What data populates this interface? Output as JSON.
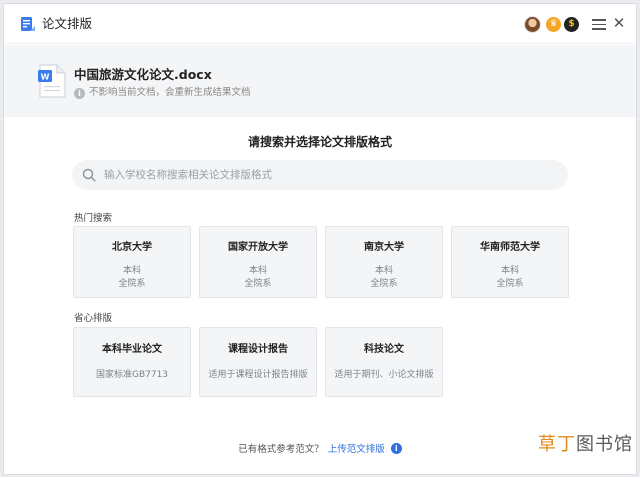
{
  "app": {
    "title": "论文排版"
  },
  "badges": {
    "vip": "♛",
    "coin": "$"
  },
  "file": {
    "name": "中国旅游文化论文.docx",
    "note": "不影响当前文档，会重新生成结果文档",
    "doc_letter": "W"
  },
  "main": {
    "heading": "请搜索并选择论文排版格式",
    "search_placeholder": "输入学校名称搜索相关论文排版格式"
  },
  "hot": {
    "label": "热门搜索",
    "cards": [
      {
        "title": "北京大学",
        "level": "本科",
        "scope": "全院系"
      },
      {
        "title": "国家开放大学",
        "level": "本科",
        "scope": "全院系"
      },
      {
        "title": "南京大学",
        "level": "本科",
        "scope": "全院系"
      },
      {
        "title": "华南师范大学",
        "level": "本科",
        "scope": "全院系"
      }
    ]
  },
  "easy": {
    "label": "省心排版",
    "cards": [
      {
        "title": "本科毕业论文",
        "desc": "国家标准GB7713"
      },
      {
        "title": "课程设计报告",
        "desc": "适用于课程设计报告排版"
      },
      {
        "title": "科技论文",
        "desc": "适用于期刊、小论文排版"
      }
    ]
  },
  "footer": {
    "question": "已有格式参考范文？",
    "link": "上传范文排版"
  },
  "watermark": {
    "accent": "草丁",
    "rest": "图书馆"
  },
  "colors": {
    "link": "#2f6fe0",
    "accent_watermark": "#e08a1e",
    "panel": "#f4f5f7"
  }
}
